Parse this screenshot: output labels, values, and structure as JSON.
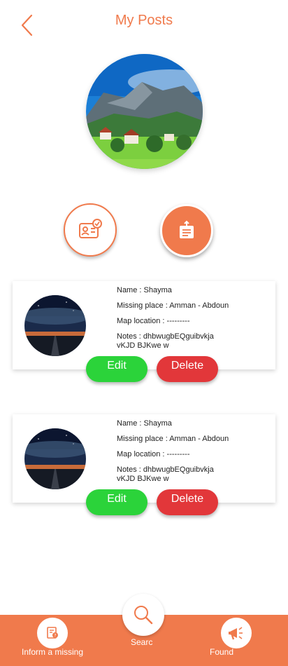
{
  "header": {
    "title": "My Posts",
    "back_icon": "chevron-left-icon"
  },
  "colors": {
    "accent": "#f07a4c",
    "edit": "#2bd33a",
    "delete": "#e2373a"
  },
  "actions": {
    "id_icon": "id-card-check-icon",
    "post_icon": "notepad-upload-icon"
  },
  "posts": [
    {
      "name": "Name : Shayma",
      "place": "Missing place : Amman - Abdoun",
      "map": "Map location : ---------",
      "notes_line1": "Notes : dhbwugbEQguibvkja",
      "notes_line2": "vKJD BJKwe w",
      "edit_label": "Edit",
      "delete_label": "Delete"
    },
    {
      "name": "Name : Shayma",
      "place": "Missing place : Amman - Abdoun",
      "map": "Map location : ---------",
      "notes_line1": "Notes : dhbwugbEQguibvkja",
      "notes_line2": "vKJD BJKwe w",
      "edit_label": "Edit",
      "delete_label": "Delete"
    }
  ],
  "bottom_nav": {
    "inform_label": "Inform a missing",
    "search_label": "Searc",
    "found_label": "Found",
    "inform_icon": "report-person-icon",
    "search_icon": "search-icon",
    "found_icon": "megaphone-icon"
  }
}
